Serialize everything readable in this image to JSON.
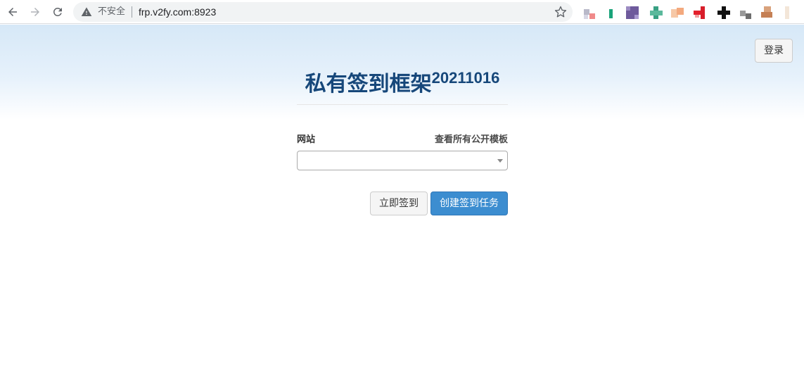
{
  "browser": {
    "security_status": "不安全",
    "url": "frp.v2fy.com:8923",
    "extensions": [
      "extension-1-icon",
      "extension-2-icon",
      "extension-3-icon",
      "extension-4-icon",
      "extension-5-icon",
      "extension-6-icon",
      "extension-7-icon",
      "extension-8-icon",
      "extension-9-icon",
      "extension-10-icon"
    ]
  },
  "header": {
    "login_label": "登录",
    "title": "私有签到框架",
    "version": "20211016"
  },
  "form": {
    "site_label": "网站",
    "templates_link": "查看所有公开模板",
    "site_value": ""
  },
  "actions": {
    "sign_now_label": "立即签到",
    "create_task_label": "创建签到任务"
  },
  "colors": {
    "title": "#16477a",
    "primary": "#3c8dd0",
    "hero_top": "#d6e8f7"
  }
}
